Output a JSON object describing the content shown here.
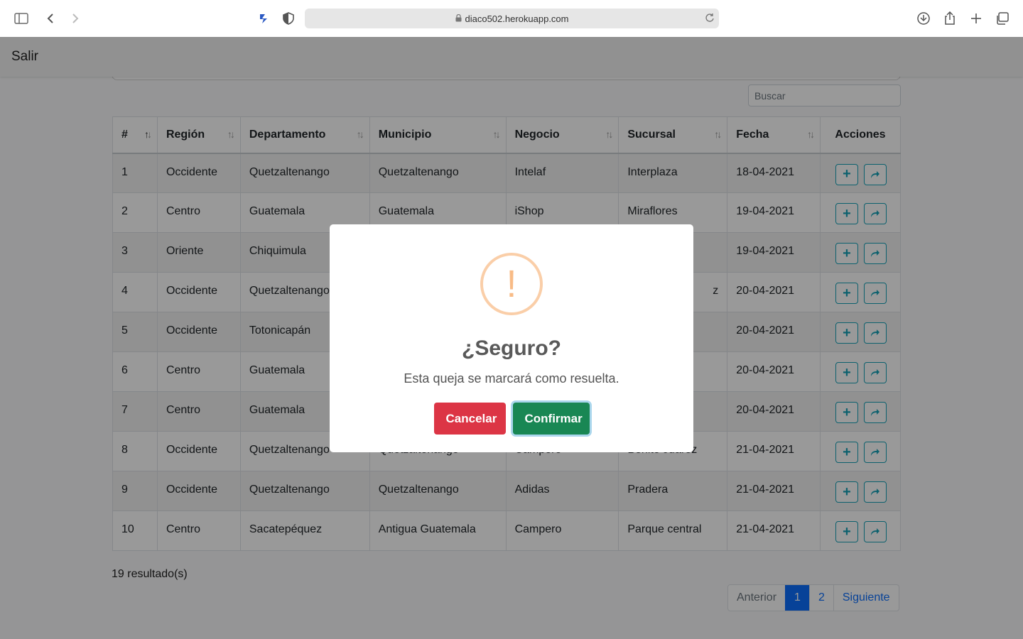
{
  "browser": {
    "url": "diaco502.herokuapp.com"
  },
  "navbar": {
    "logout_label": "Salir"
  },
  "search": {
    "placeholder": "Buscar"
  },
  "table": {
    "headers": [
      "#",
      "Región",
      "Departamento",
      "Municipio",
      "Negocio",
      "Sucursal",
      "Fecha",
      "Acciones"
    ],
    "rows": [
      [
        "1",
        "Occidente",
        "Quetzaltenango",
        "Quetzaltenango",
        "Intelaf",
        "Interplaza",
        "18-04-2021"
      ],
      [
        "2",
        "Centro",
        "Guatemala",
        "Guatemala",
        "iShop",
        "Miraflores",
        "19-04-2021"
      ],
      [
        "3",
        "Oriente",
        "Chiquimula",
        "",
        "",
        "",
        "19-04-2021"
      ],
      [
        "4",
        "Occidente",
        "Quetzaltenango",
        "",
        "",
        "z",
        "20-04-2021"
      ],
      [
        "5",
        "Occidente",
        "Totonicapán",
        "",
        "",
        "",
        "20-04-2021"
      ],
      [
        "6",
        "Centro",
        "Guatemala",
        "",
        "",
        "",
        "20-04-2021"
      ],
      [
        "7",
        "Centro",
        "Guatemala",
        "",
        "",
        "",
        "20-04-2021"
      ],
      [
        "8",
        "Occidente",
        "Quetzaltenango",
        "Quetzaltenango",
        "Campero",
        "Benito Juárez",
        "21-04-2021"
      ],
      [
        "9",
        "Occidente",
        "Quetzaltenango",
        "Quetzaltenango",
        "Adidas",
        "Pradera",
        "21-04-2021"
      ],
      [
        "10",
        "Centro",
        "Sacatepéquez",
        "Antigua Guatemala",
        "Campero",
        "Parque central",
        "21-04-2021"
      ]
    ]
  },
  "results_text": "19 resultado(s)",
  "pagination": {
    "prev": "Anterior",
    "pages": [
      "1",
      "2"
    ],
    "active": "1",
    "next": "Siguiente"
  },
  "modal": {
    "icon": "!",
    "title": "¿Seguro?",
    "text": "Esta queja se marcará como resuelta.",
    "cancel_label": "Cancelar",
    "confirm_label": "Confirmar"
  },
  "colors": {
    "cancel": "#dc3545",
    "confirm": "#198754",
    "info": "#17a2b8",
    "primary": "#0d6efd",
    "warning": "#f8bb86"
  }
}
